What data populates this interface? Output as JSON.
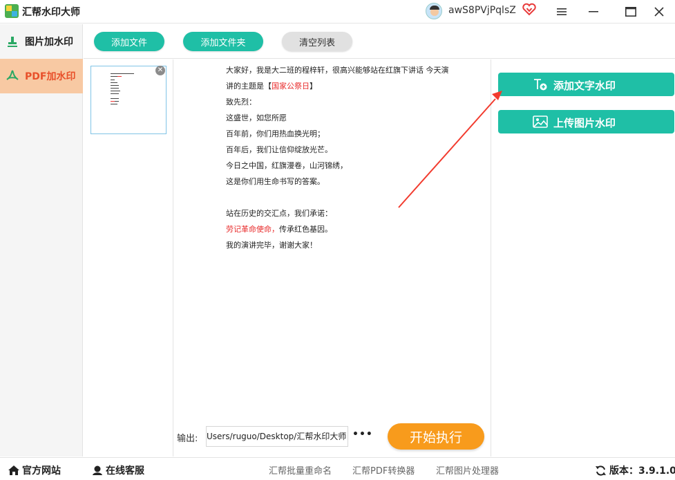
{
  "app": {
    "title": "汇帮水印大师",
    "username": "awS8PVjPqlsZ"
  },
  "sidebar": {
    "items": [
      {
        "label": "图片加水印",
        "icon": "image-stamp-icon",
        "active": false
      },
      {
        "label": "PDF加水印",
        "icon": "pdf-icon",
        "active": true
      }
    ]
  },
  "toolbar": {
    "add_file": "添加文件",
    "add_folder": "添加文件夹",
    "clear_list": "清空列表"
  },
  "preview": {
    "lines": [
      [
        "大家好，我是大二班的程梓轩，很高兴能够站在红旗下讲话 今天演"
      ],
      [
        "讲的主题是【",
        "国家公祭日",
        "】"
      ],
      [
        "致先烈："
      ],
      [
        "这盛世，如您所愿"
      ],
      [
        "百年前，你们用热血换光明；"
      ],
      [
        "百年后，我们让信仰绽放光芒。"
      ],
      [
        "今日之中国，红旗漫卷，山河锦绣，"
      ],
      [
        "这是你们用生命书写的答案。"
      ],
      [
        ""
      ],
      [
        "站在历史的交汇点，我们承诺："
      ],
      [
        "劳记革命使命，",
        "传承红色基因。"
      ],
      [
        "我的演讲完毕，谢谢大家！"
      ]
    ]
  },
  "output": {
    "label": "输出:",
    "path": "Users/ruguo/Desktop/汇帮水印大师",
    "more": "•••"
  },
  "start_button": "开始执行",
  "right_panel": {
    "add_text_watermark": "添加文字水印",
    "upload_image_watermark": "上传图片水印"
  },
  "statusbar": {
    "official_site": "官方网站",
    "online_support": "在线客服",
    "links": [
      "汇帮批量重命名",
      "汇帮PDF转换器",
      "汇帮图片处理器"
    ],
    "version": "版本：3.9.1.0"
  },
  "colors": {
    "accent": "#1fbfa6",
    "start": "#f89b1c",
    "active_bg": "#f8c9a3",
    "active_text": "#e8502a",
    "highlight": "#e82a2a"
  }
}
